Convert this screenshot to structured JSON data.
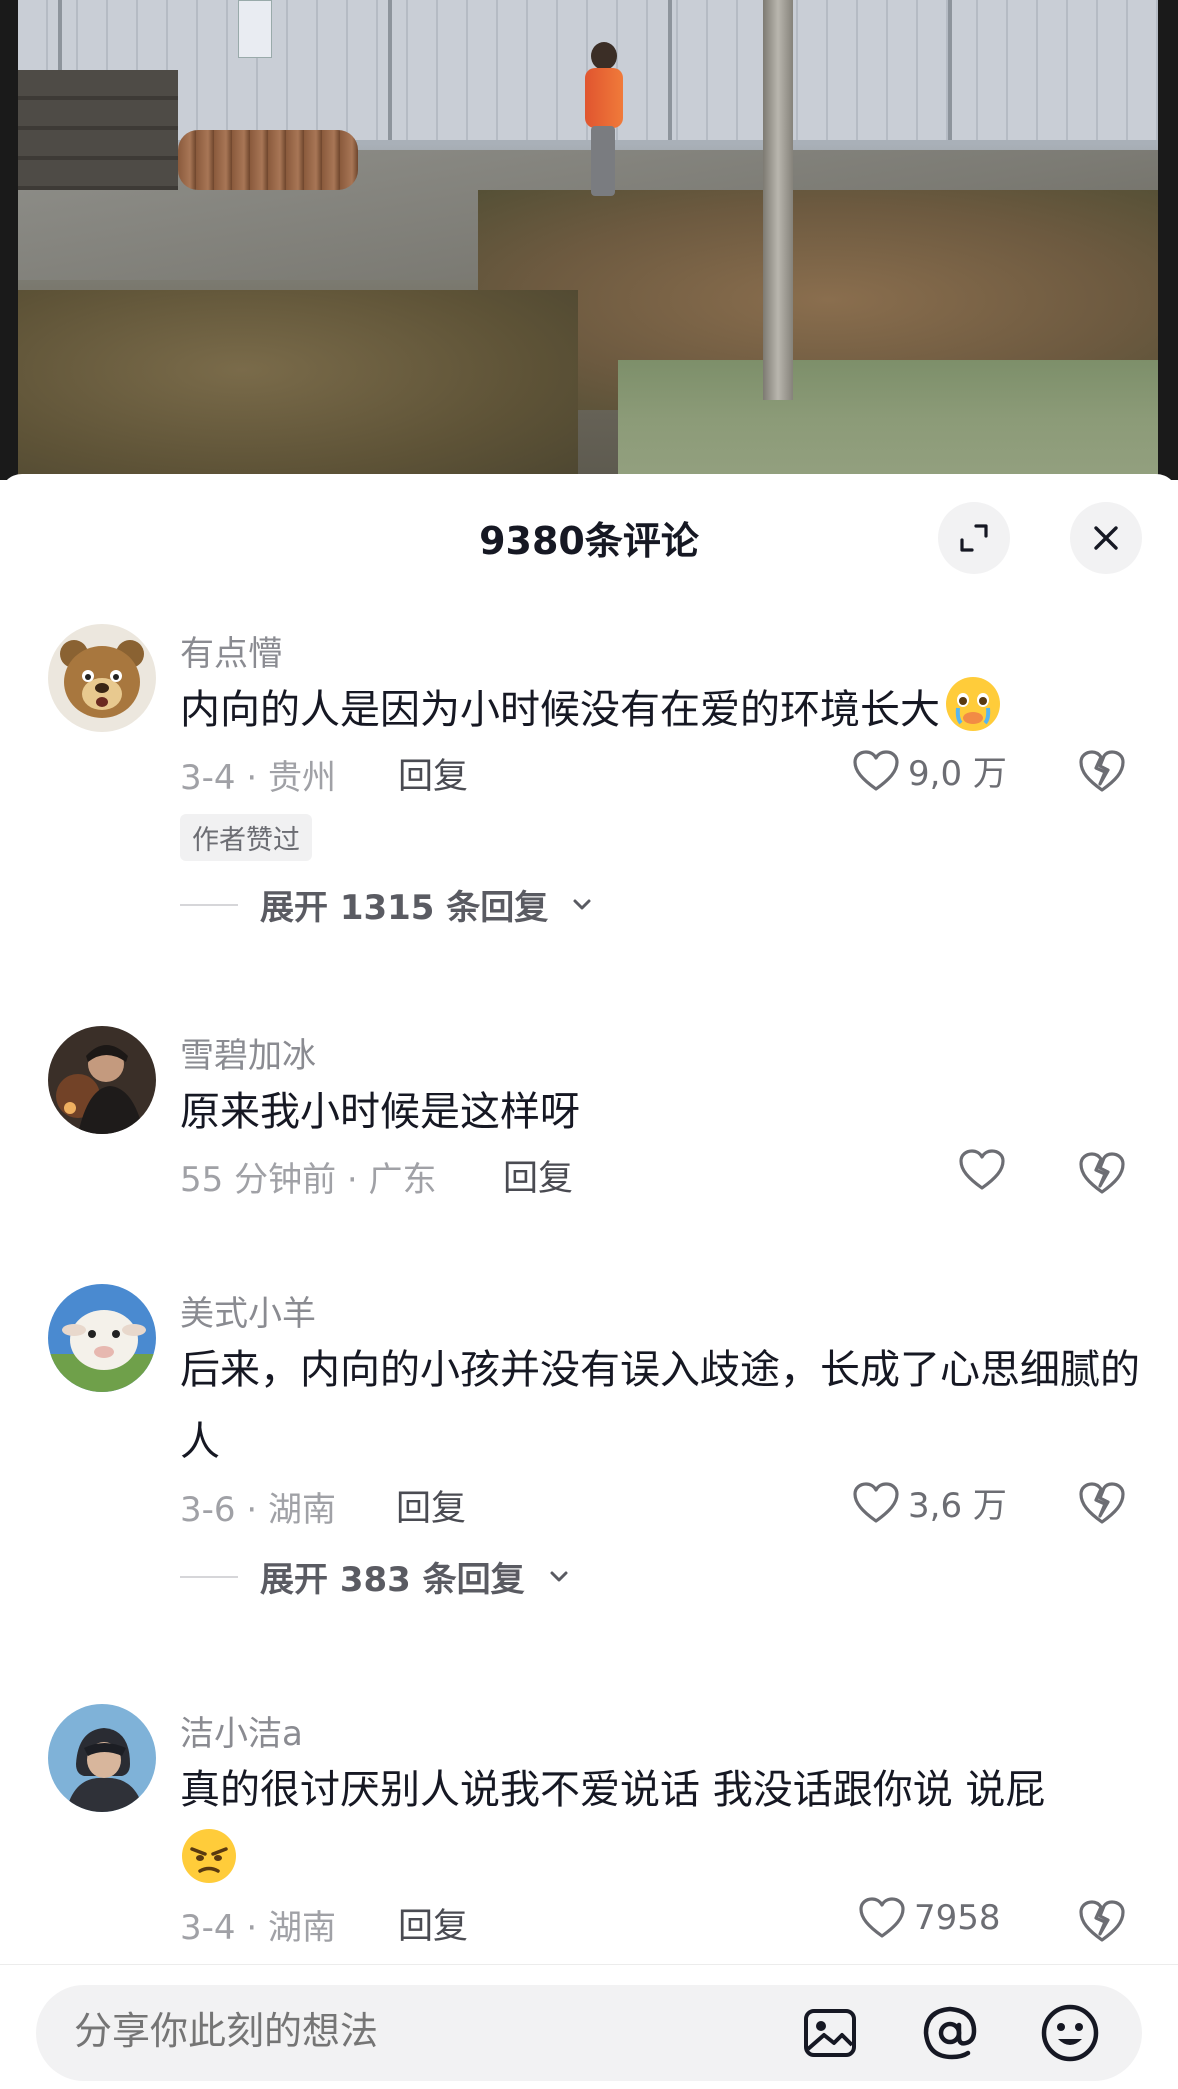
{
  "sheet": {
    "title": "9380条评论",
    "expand_icon": "expand-icon",
    "close_icon": "close-icon"
  },
  "comments": [
    {
      "username": "有点懵",
      "text": "内向的人是因为小时候没有在爱的环境长大",
      "emoji": "crying-face-emoji",
      "meta": "3-4 · 贵州",
      "reply_label": "回复",
      "like_count": "9,0 万",
      "badge": "作者赞过",
      "expand": "展开 1315 条回复"
    },
    {
      "username": "雪碧加冰",
      "text": "原来我小时候是这样呀",
      "meta": "55 分钟前 · 广东",
      "reply_label": "回复",
      "like_count": ""
    },
    {
      "username": "美式小羊",
      "text": "后来，内向的小孩并没有误入歧途，长成了心思细腻的人",
      "meta": "3-6 · 湖南",
      "reply_label": "回复",
      "like_count": "3,6 万",
      "expand": "展开 383 条回复"
    },
    {
      "username": "洁小洁a",
      "text": "真的很讨厌别人说我不爱说话 我没话跟你说 说屁",
      "emoji": "angry-face-emoji",
      "meta": "3-4 · 湖南",
      "reply_label": "回复",
      "like_count": "7958"
    }
  ],
  "input_bar": {
    "placeholder": "分享你此刻的想法",
    "icons": [
      "image-icon",
      "at-icon",
      "emoji-icon"
    ]
  },
  "colors": {
    "accent_text": "#161823",
    "secondary_text": "#8a8b91",
    "background": "#ffffff",
    "input_bg": "#f2f2f3"
  }
}
